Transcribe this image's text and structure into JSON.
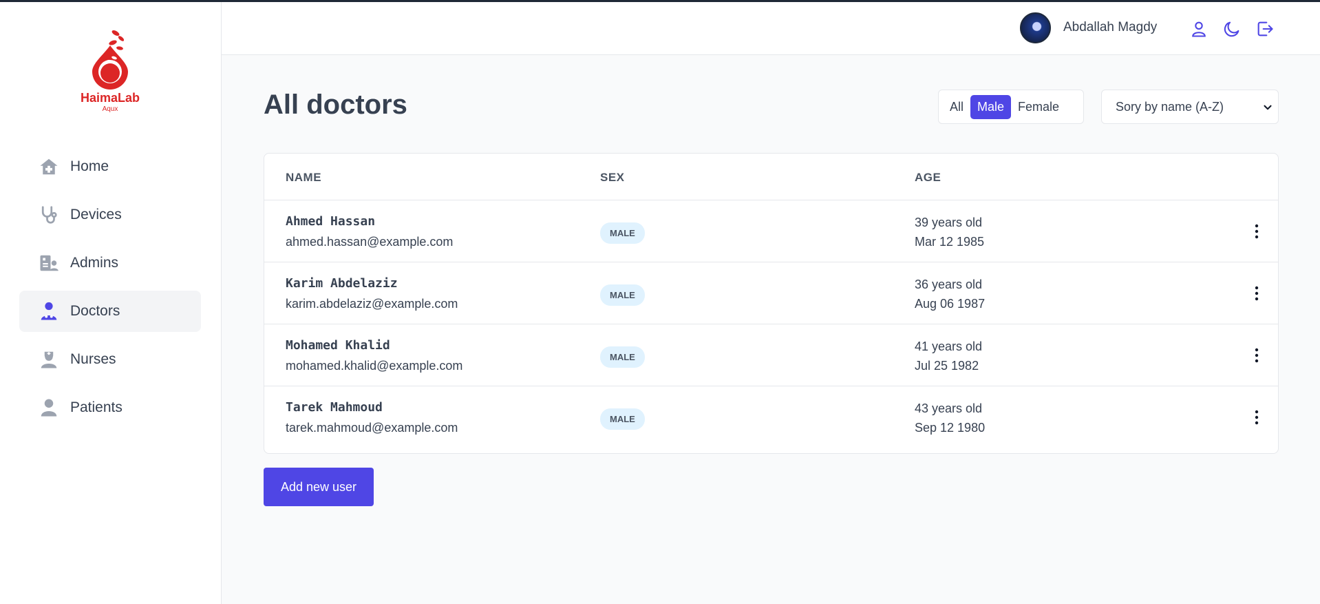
{
  "brand": {
    "name": "HaimaLab",
    "sub": "Aqux",
    "color": "#dc2626"
  },
  "sidebar": {
    "items": [
      {
        "label": "Home",
        "icon": "home-icon"
      },
      {
        "label": "Devices",
        "icon": "stethoscope-icon"
      },
      {
        "label": "Admins",
        "icon": "id-card-icon"
      },
      {
        "label": "Doctors",
        "icon": "doctor-icon",
        "active": true
      },
      {
        "label": "Nurses",
        "icon": "nurse-icon"
      },
      {
        "label": "Patients",
        "icon": "user-icon"
      }
    ]
  },
  "header": {
    "username": "Abdallah Magdy",
    "icons": [
      "profile-icon",
      "moon-icon",
      "logout-icon"
    ]
  },
  "main": {
    "title": "All doctors",
    "filters": [
      {
        "label": "All",
        "active": false
      },
      {
        "label": "Male",
        "active": true
      },
      {
        "label": "Female",
        "active": false
      }
    ],
    "sort": {
      "selected": "Sory by name (A-Z)"
    },
    "table": {
      "columns": [
        "NAME",
        "SEX",
        "AGE"
      ],
      "rows": [
        {
          "name": "Ahmed Hassan",
          "email": "ahmed.hassan@example.com",
          "sex": "MALE",
          "age": "39 years old",
          "dob": "Mar 12 1985"
        },
        {
          "name": "Karim Abdelaziz",
          "email": "karim.abdelaziz@example.com",
          "sex": "MALE",
          "age": "36 years old",
          "dob": "Aug 06 1987"
        },
        {
          "name": "Mohamed Khalid",
          "email": "mohamed.khalid@example.com",
          "sex": "MALE",
          "age": "41 years old",
          "dob": "Jul 25 1982"
        },
        {
          "name": "Tarek Mahmoud",
          "email": "tarek.mahmoud@example.com",
          "sex": "MALE",
          "age": "43 years old",
          "dob": "Sep 12 1980"
        }
      ]
    },
    "add_button": "Add new user"
  },
  "colors": {
    "accent": "#4f46e5",
    "badge_bg": "#e0f2fe",
    "icon_gray": "#9ca3af"
  }
}
